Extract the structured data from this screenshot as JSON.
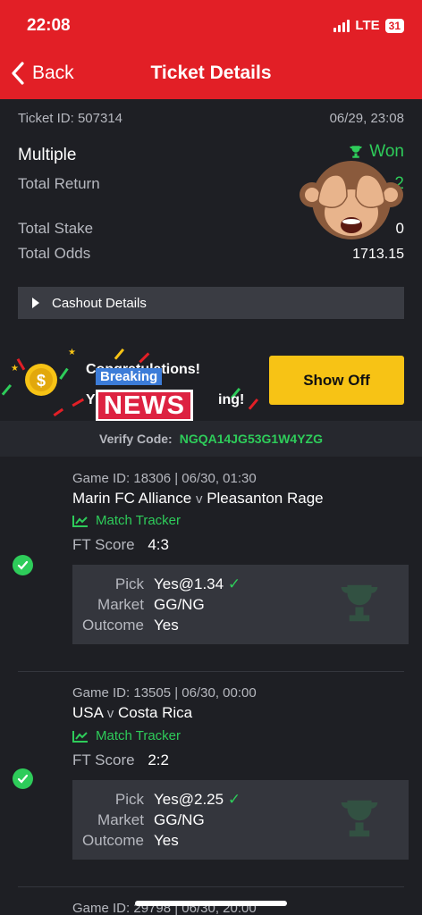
{
  "status": {
    "time": "22:08",
    "network": "LTE",
    "battery": "31"
  },
  "nav": {
    "back_label": "Back",
    "title": "Ticket Details"
  },
  "ticket": {
    "id_text": "Ticket ID: 507314",
    "date": "06/29, 23:08",
    "type": "Multiple",
    "status": "Won",
    "total_return_label": "Total Return",
    "total_return_value": "2",
    "total_stake_label": "Total Stake",
    "total_stake_value": "0",
    "total_odds_label": "Total Odds",
    "total_odds_value": "1713.15"
  },
  "cashout": {
    "label": "Cashout Details"
  },
  "promo": {
    "line1": "Congratulations!",
    "line2": "ing!",
    "line2_prefix": "Y",
    "breaking": "Breaking",
    "news": "NEWS",
    "button": "Show Off"
  },
  "verify": {
    "label": "Verify Code:",
    "code": "NGQA14JG53G1W4YZG"
  },
  "games": [
    {
      "id_text": "Game ID: 18306 | 06/30, 01:30",
      "home": "Marin FC Alliance",
      "v": "v",
      "away": "Pleasanton Rage",
      "tracker": "Match Tracker",
      "ft_label": "FT Score",
      "ft_score": "4:3",
      "pick_label": "Pick",
      "pick": "Yes@1.34",
      "market_label": "Market",
      "market": "GG/NG",
      "outcome_label": "Outcome",
      "outcome": "Yes"
    },
    {
      "id_text": "Game ID: 13505 | 06/30, 00:00",
      "home": "USA",
      "v": "v",
      "away": "Costa Rica",
      "tracker": "Match Tracker",
      "ft_label": "FT Score",
      "ft_score": "2:2",
      "pick_label": "Pick",
      "pick": "Yes@2.25",
      "market_label": "Market",
      "market": "GG/NG",
      "outcome_label": "Outcome",
      "outcome": "Yes"
    },
    {
      "id_text": "Game ID: 29798 | 06/30, 20:00"
    }
  ],
  "colors": {
    "brand_red": "#e21f26",
    "win_green": "#2ecc5a",
    "cta_yellow": "#f7c315"
  },
  "icons": [
    "back-chevron-icon",
    "trophy-icon",
    "check-icon",
    "tracker-chart-icon",
    "play-triangle-icon",
    "coin-icon",
    "monkey-emoji"
  ]
}
